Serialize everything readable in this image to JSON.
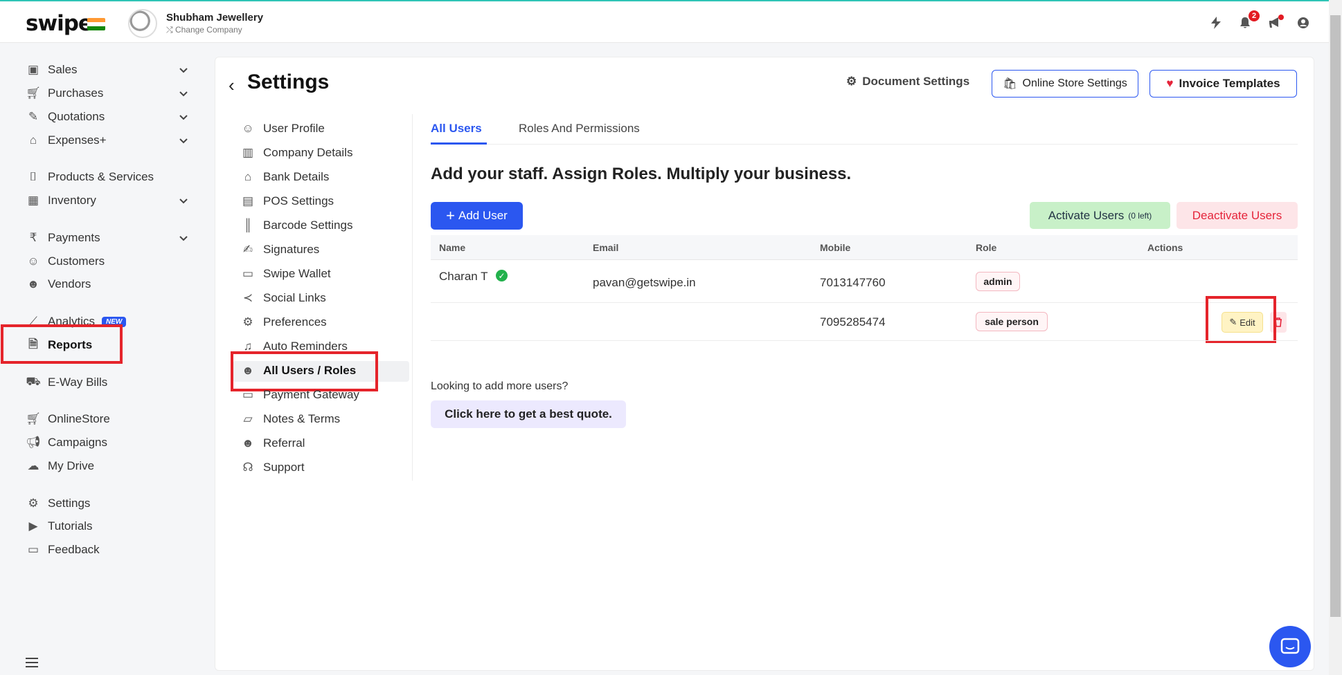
{
  "header": {
    "logo": "swipe",
    "company_name": "Shubham Jewellery",
    "change_company": "Change Company",
    "notification_count": "2"
  },
  "leftnav": {
    "items": [
      {
        "label": "Sales",
        "icon": "money-icon"
      },
      {
        "label": "Purchases",
        "icon": "cart-icon"
      },
      {
        "label": "Quotations",
        "icon": "pen-icon"
      },
      {
        "label": "Expenses+",
        "icon": "tag-icon"
      },
      {
        "label": "Products & Services",
        "icon": "barcode-scan-icon"
      },
      {
        "label": "Inventory",
        "icon": "factory-icon"
      },
      {
        "label": "Payments",
        "icon": "rupee-icon"
      },
      {
        "label": "Customers",
        "icon": "user-icon"
      },
      {
        "label": "Vendors",
        "icon": "users-icon"
      },
      {
        "label": "Analytics",
        "icon": "chart-icon",
        "badge": "NEW"
      },
      {
        "label": "Reports",
        "icon": "report-icon"
      },
      {
        "label": "E-Way Bills",
        "icon": "truck-icon"
      },
      {
        "label": "OnlineStore",
        "icon": "store-icon"
      },
      {
        "label": "Campaigns",
        "icon": "megaphone-icon"
      },
      {
        "label": "My Drive",
        "icon": "cloud-icon"
      },
      {
        "label": "Settings",
        "icon": "gear-icon"
      },
      {
        "label": "Tutorials",
        "icon": "youtube-icon"
      },
      {
        "label": "Feedback",
        "icon": "chat-bubble-icon"
      }
    ]
  },
  "settings": {
    "title": "Settings",
    "document_settings": "Document Settings",
    "online_store_settings": "Online Store Settings",
    "invoice_templates": "Invoice Templates",
    "subnav": [
      {
        "label": "User Profile"
      },
      {
        "label": "Company Details"
      },
      {
        "label": "Bank Details"
      },
      {
        "label": "POS Settings"
      },
      {
        "label": "Barcode Settings"
      },
      {
        "label": "Signatures"
      },
      {
        "label": "Swipe Wallet"
      },
      {
        "label": "Social Links"
      },
      {
        "label": "Preferences"
      },
      {
        "label": "Auto Reminders"
      },
      {
        "label": "All Users / Roles"
      },
      {
        "label": "Payment Gateway"
      },
      {
        "label": "Notes & Terms"
      },
      {
        "label": "Referral"
      },
      {
        "label": "Support"
      }
    ]
  },
  "users": {
    "tabs": [
      "All Users",
      "Roles And Permissions"
    ],
    "headline": "Add your staff. Assign Roles. Multiply your business.",
    "add_user": "Add User",
    "activate_users": "Activate Users",
    "activate_left": "(0 left)",
    "deactivate_users": "Deactivate Users",
    "columns": [
      "Name",
      "Email",
      "Mobile",
      "Role",
      "Actions"
    ],
    "rows": [
      {
        "name": "Charan T",
        "email": "pavan@getswipe.in",
        "mobile": "7013147760",
        "role": "admin"
      },
      {
        "name": "",
        "email": "",
        "mobile": "7095285474",
        "role": "sale person"
      }
    ],
    "edit_label": "Edit",
    "more_question": "Looking to add more users?",
    "quote_button": "Click here to get a best quote."
  },
  "colors": {
    "accent": "#2b57f0",
    "highlight": "#e5242b",
    "danger": "#e5243a",
    "success": "#22b14c"
  }
}
